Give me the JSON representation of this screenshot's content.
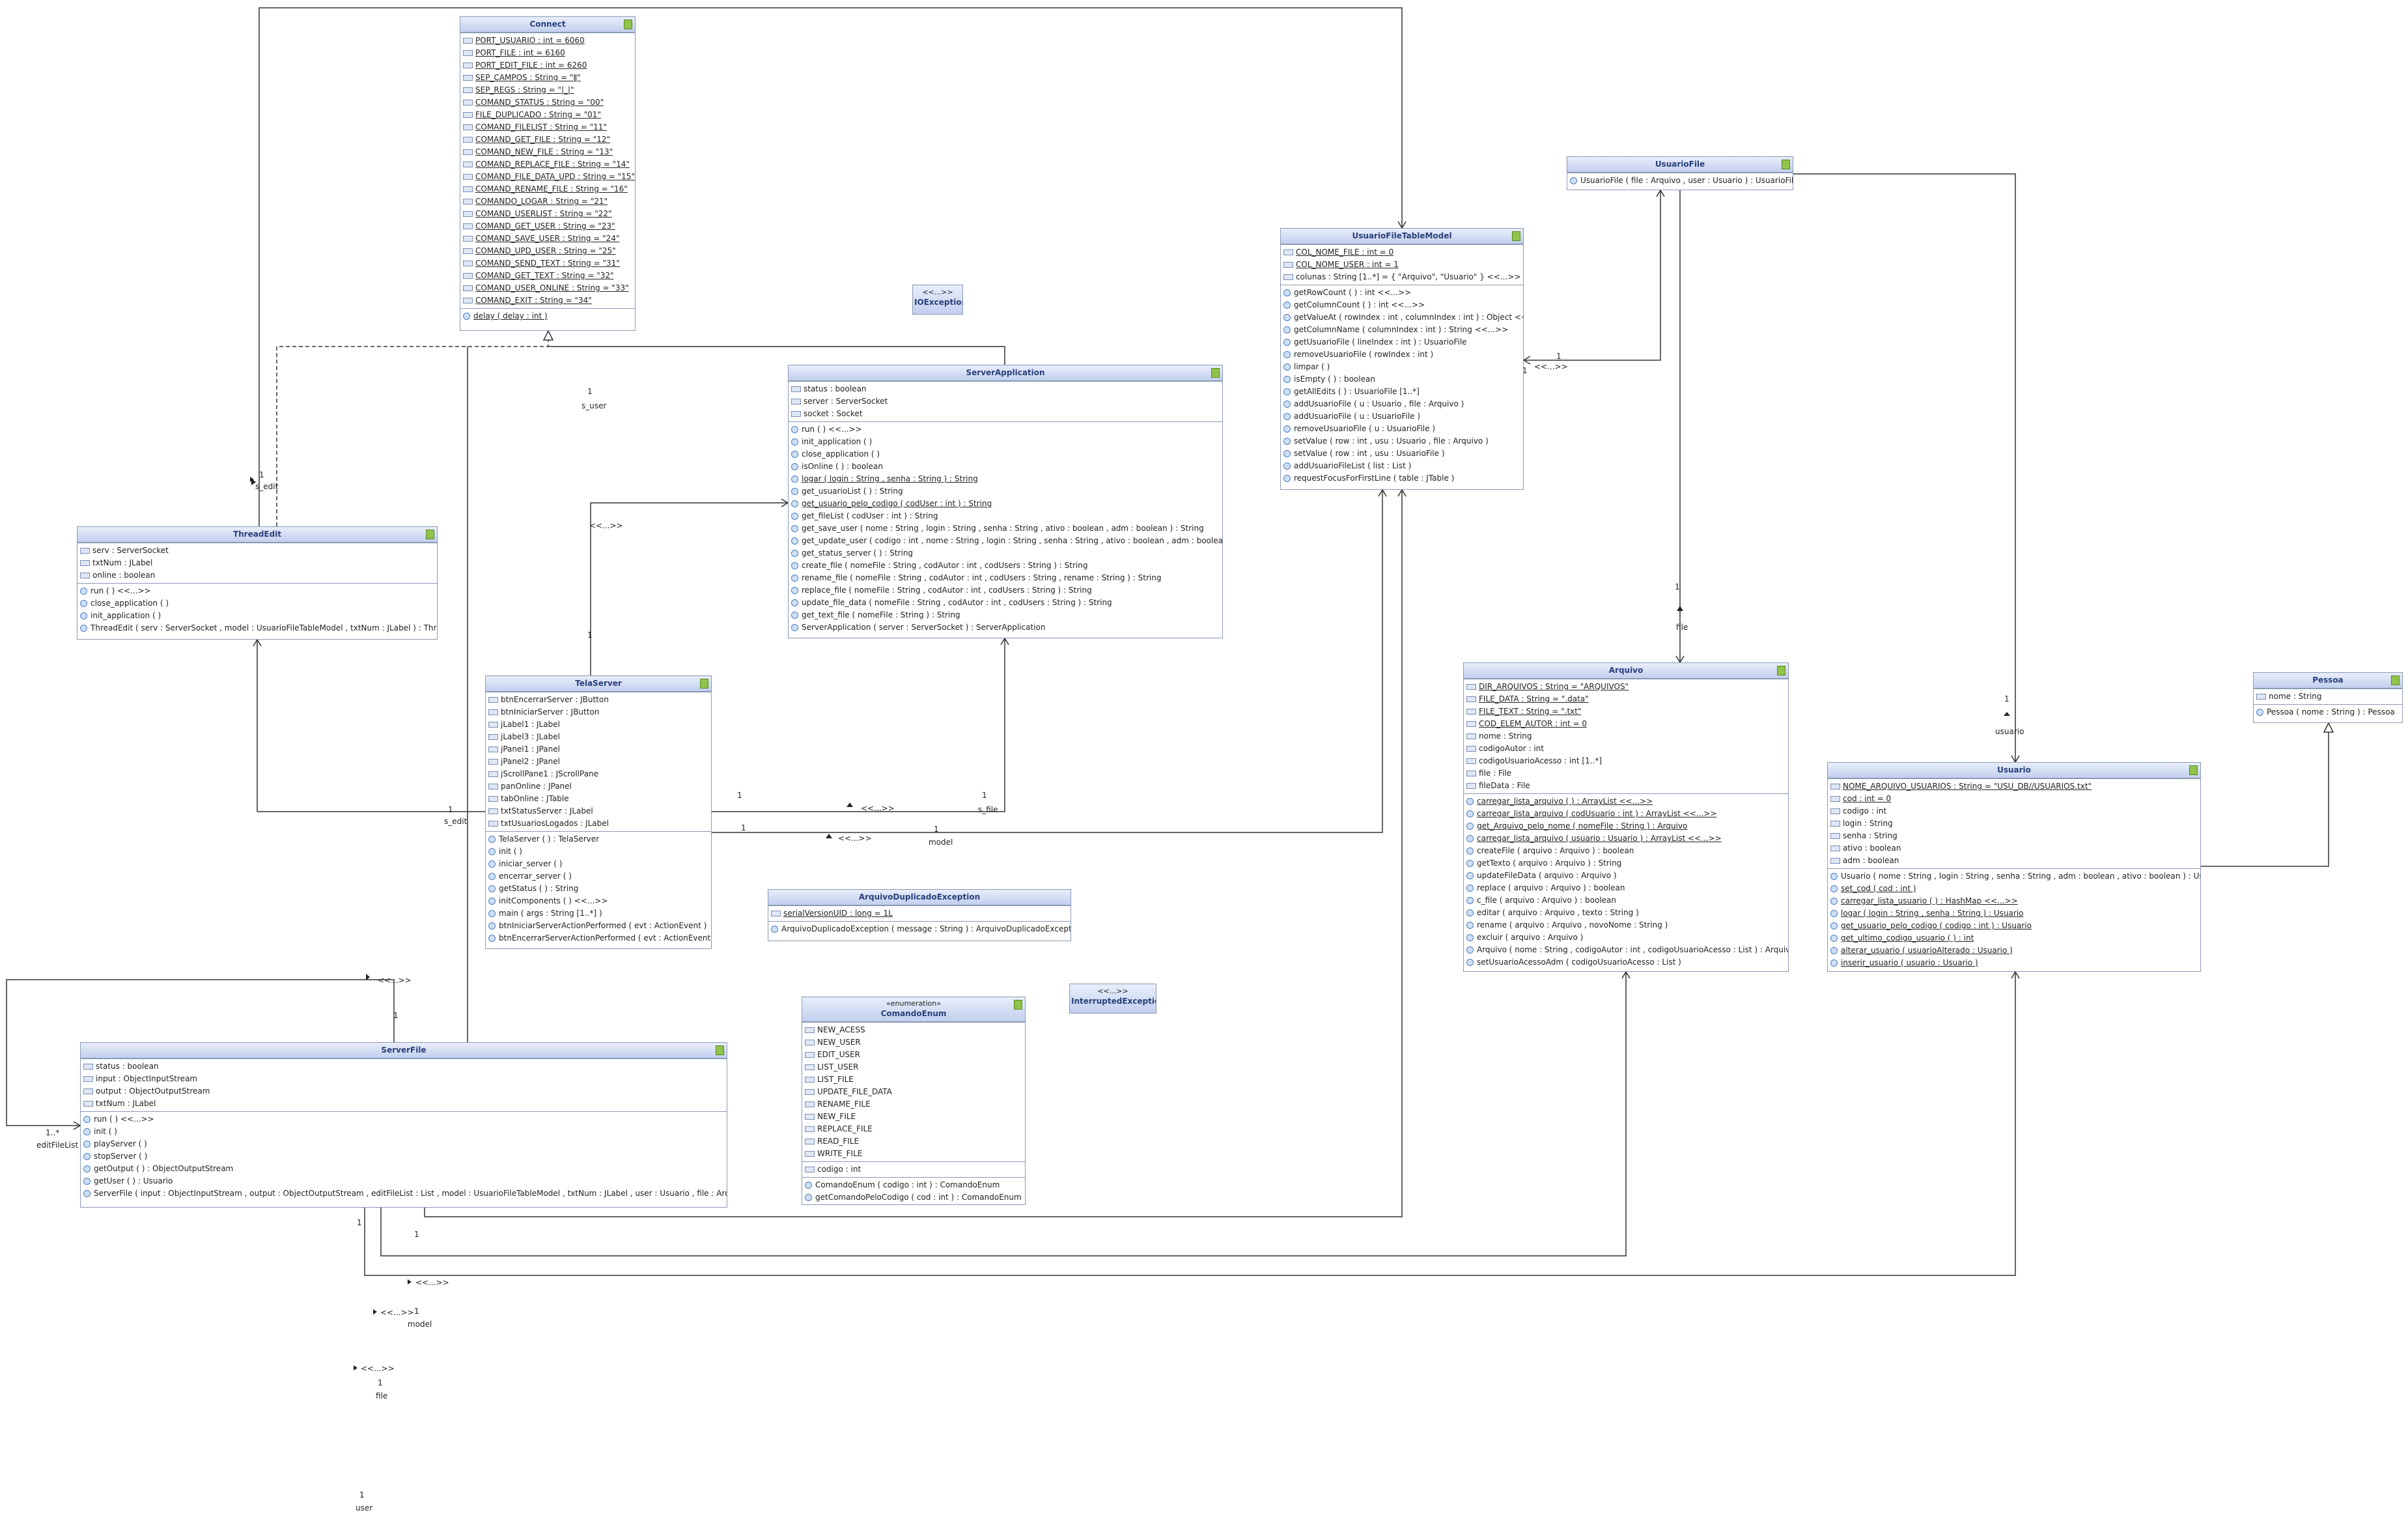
{
  "classes": {
    "connect": {
      "name": "Connect",
      "fields": [
        "PORT_USUARIO : int = 6060",
        "PORT_FILE : int = 6160",
        "PORT_EDIT_FILE : int = 6260",
        "SEP_CAMPOS : String = \"ǁ\"",
        "SEP_REGS : String = \"|_|\"",
        "COMAND_STATUS : String = \"00\"",
        "FILE_DUPLICADO : String = \"01\"",
        "COMAND_FILELIST : String = \"11\"",
        "COMAND_GET_FILE : String = \"12\"",
        "COMAND_NEW_FILE : String = \"13\"",
        "COMAND_REPLACE_FILE : String = \"14\"",
        "COMAND_FILE_DATA_UPD : String = \"15\"",
        "COMAND_RENAME_FILE : String = \"16\"",
        "COMANDO_LOGAR : String = \"21\"",
        "COMAND_USERLIST : String = \"22\"",
        "COMAND_GET_USER : String = \"23\"",
        "COMAND_SAVE_USER : String = \"24\"",
        "COMAND_UPD_USER : String = \"25\"",
        "COMAND_SEND_TEXT : String = \"31\"",
        "COMAND_GET_TEXT : String = \"32\"",
        "COMAND_USER_ONLINE : String = \"33\"",
        "COMAND_EXIT : String = \"34\""
      ],
      "methods": [
        "delay ( delay : int )"
      ]
    },
    "ioexception": {
      "stereotype": "<<...>>",
      "name": "IOException"
    },
    "server_application": {
      "name": "ServerApplication",
      "fields": [
        "status : boolean",
        "server : ServerSocket",
        "socket : Socket"
      ],
      "methods": [
        "run ( ) <<...>>",
        "init_application ( )",
        "close_application ( )",
        "isOnline ( ) : boolean",
        "logar ( login : String , senha : String ) : String",
        "get_usuarioList ( ) : String",
        "get_usuario_pelo_codigo ( codUser : int ) : String",
        "get_fileList ( codUser : int ) : String",
        "get_save_user ( nome : String , login : String , senha : String , ativo : boolean , adm : boolean ) : String",
        "get_update_user ( codigo : int , nome : String , login : String , senha : String , ativo : boolean , adm : boolean ) : String",
        "get_status_server ( ) : String",
        "create_file ( nomeFile : String , codAutor : int , codUsers : String ) : String",
        "rename_file ( nomeFile : String , codAutor : int , codUsers : String , rename : String ) : String",
        "replace_file ( nomeFile : String , codAutor : int , codUsers : String ) : String",
        "update_file_data ( nomeFile : String , codAutor : int , codUsers : String ) : String",
        "get_text_file ( nomeFile : String ) : String",
        "ServerApplication ( server : ServerSocket ) : ServerApplication"
      ]
    },
    "thread_edit": {
      "name": "ThreadEdit",
      "fields": [
        "serv : ServerSocket",
        "txtNum : JLabel",
        "online : boolean"
      ],
      "methods": [
        "run ( ) <<...>>",
        "close_application ( )",
        "init_application ( )",
        "ThreadEdit ( serv : ServerSocket , model : UsuarioFileTableModel , txtNum : JLabel ) : ThreadEdit"
      ]
    },
    "tela_server": {
      "name": "TelaServer",
      "fields": [
        "btnEncerrarServer : JButton",
        "btnIniciarServer : JButton",
        "jLabel1 : JLabel",
        "jLabel3 : JLabel",
        "jPanel1 : JPanel",
        "jPanel2 : JPanel",
        "jScrollPane1 : JScrollPane",
        "panOnline : JPanel",
        "tabOnline : JTable",
        "txtStatusServer : JLabel",
        "txtUsuariosLogados : JLabel"
      ],
      "methods": [
        "TelaServer ( ) : TelaServer",
        "init ( )",
        "iniciar_server ( )",
        "encerrar_server ( )",
        "getStatus ( ) : String",
        "initComponents ( ) <<...>>",
        "main ( args : String [1..*] )",
        "btnIniciarServerActionPerformed ( evt : ActionEvent )",
        "btnEncerrarServerActionPerformed ( evt : ActionEvent )"
      ]
    },
    "arquivo_duplicado": {
      "name": "ArquivoDuplicadoException",
      "fields": [
        "serialVersionUID : long = 1L"
      ],
      "methods": [
        "ArquivoDuplicadoException ( message : String ) : ArquivoDuplicadoException"
      ]
    },
    "interrupted": {
      "stereotype": "<<...>>",
      "name": "InterruptedException"
    },
    "comando_enum": {
      "stereotype": "«enumeration»",
      "name": "ComandoEnum",
      "literals": [
        "NEW_ACESS",
        "NEW_USER",
        "EDIT_USER",
        "LIST_USER",
        "LIST_FILE",
        "UPDATE_FILE_DATA",
        "RENAME_FILE",
        "NEW_FILE",
        "REPLACE_FILE",
        "READ_FILE",
        "WRITE_FILE"
      ],
      "fields": [
        "codigo : int"
      ],
      "methods": [
        "ComandoEnum ( codigo : int ) : ComandoEnum",
        "getComandoPeloCodigo ( cod : int ) : ComandoEnum"
      ]
    },
    "server_file": {
      "name": "ServerFile",
      "fields": [
        "status : boolean",
        "input : ObjectInputStream",
        "output : ObjectOutputStream",
        "txtNum : JLabel"
      ],
      "methods": [
        "run ( ) <<...>>",
        "init ( )",
        "playServer ( )",
        "stopServer ( )",
        "getOutput ( ) : ObjectOutputStream",
        "getUser ( ) : Usuario",
        "ServerFile ( input : ObjectInputStream , output : ObjectOutputStream , editFileList : List , model : UsuarioFileTableModel , txtNum : JLabel , user : Usuario , file : Arquivo ) : ServerFile"
      ]
    },
    "usuario_file_table_model": {
      "name": "UsuarioFileTableModel",
      "fields": [
        "COL_NOME_FILE : int = 0",
        "COL_NOME_USER : int = 1",
        "colunas : String [1..*] = { \"Arquivo\", \"Usuario\" } <<...>>"
      ],
      "methods": [
        "getRowCount ( ) : int <<...>>",
        "getColumnCount ( ) : int <<...>>",
        "getValueAt ( rowIndex : int , columnIndex : int ) : Object <<...>>",
        "getColumnName ( columnIndex : int ) : String <<...>>",
        "getUsuarioFile ( lineIndex : int ) : UsuarioFile",
        "removeUsuarioFile ( rowIndex : int )",
        "limpar ( )",
        "isEmpty ( ) : boolean",
        "getAllEdits ( ) : UsuarioFile [1..*]",
        "addUsuarioFile ( u : Usuario , file : Arquivo )",
        "addUsuarioFile ( u : UsuarioFile )",
        "removeUsuarioFile ( u : UsuarioFile )",
        "setValue ( row : int , usu : Usuario , file : Arquivo )",
        "setValue ( row : int , usu : UsuarioFile )",
        "addUsuarioFileList ( list : List )",
        "requestFocusForFirstLine ( table : JTable )"
      ]
    },
    "usuario_file": {
      "name": "UsuarioFile",
      "methods": [
        "UsuarioFile ( file : Arquivo , user : Usuario ) : UsuarioFile"
      ]
    },
    "arquivo": {
      "name": "Arquivo",
      "fields": [
        "DIR_ARQUIVOS : String = \"ARQUIVOS\"",
        "FILE_DATA : String = \".data\"",
        "FILE_TEXT : String = \".txt\"",
        "COD_ELEM_AUTOR : int = 0",
        "nome : String",
        "codigoAutor : int",
        "codigoUsuarioAcesso : int [1..*]",
        "file : File",
        "fileData : File"
      ],
      "methods": [
        "carregar_lista_arquivo ( ) : ArrayList <<...>>",
        "carregar_lista_arquivo ( codUsuario : int ) : ArrayList <<...>>",
        "get_Arquivo_pelo_nome ( nomeFile : String ) : Arquivo",
        "carregar_lista_arquivo ( usuario : Usuario ) : ArrayList <<...>>",
        "createFile ( arquivo : Arquivo ) : boolean",
        "getTexto ( arquivo : Arquivo ) : String",
        "updateFileData ( arquivo : Arquivo )",
        "replace ( arquivo : Arquivo ) : boolean",
        "c_file ( arquivo : Arquivo ) : boolean",
        "editar ( arquivo : Arquivo , texto : String )",
        "rename ( arquivo : Arquivo , novoNome : String )",
        "excluir ( arquivo : Arquivo )",
        "Arquivo ( nome : String , codigoAutor : int , codigoUsuarioAcesso : List ) : Arquivo",
        "setUsuarioAcessoAdm ( codigoUsuarioAcesso : List )"
      ]
    },
    "pessoa": {
      "name": "Pessoa",
      "fields": [
        "nome : String"
      ],
      "methods": [
        "Pessoa ( nome : String ) : Pessoa"
      ]
    },
    "usuario": {
      "name": "Usuario",
      "fields": [
        "NOME_ARQUIVO_USUARIOS : String = \"USU_DB//USUARIOS.txt\"",
        "cod : int = 0",
        "codigo : int",
        "login : String",
        "senha : String",
        "ativo : boolean",
        "adm : boolean"
      ],
      "methods": [
        "Usuario ( nome : String , login : String , senha : String , adm : boolean , ativo : boolean ) : Usuario",
        "set_cod ( cod : int )",
        "carregar_lista_usuario ( ) : HashMap <<...>>",
        "logar ( login : String , senha : String ) : Usuario",
        "get_usuario_pelo_codigo ( codigo : int ) : Usuario",
        "get_ultimo_codigo_usuario ( ) : int",
        "alterar_usuario ( usuarioAlterado : Usuario )",
        "inserir_usuario ( usuario : Usuario )"
      ]
    }
  },
  "labels": {
    "l1": "1",
    "l2": "s_user",
    "l3": "1",
    "l4": "s_edit",
    "l5": "<<...>>",
    "l6": "1",
    "l7": "1",
    "l8": "<<...>>",
    "l9": "1",
    "l10": "s_file",
    "l11": "1",
    "l12": "<<...>>",
    "l13": "1",
    "l14": "model",
    "l15": "1",
    "l16": "s_edit",
    "l17": "<<...>>",
    "l18": "1",
    "l19": "1..*",
    "l20": "editFileList",
    "l21": "1",
    "l22": "1",
    "l23": "<<...>>",
    "l24": "<<...>>",
    "l25": "1",
    "l26": "model",
    "l27": "<<...>>",
    "l28": "1",
    "l29": "file",
    "l30": "1",
    "l31": "user",
    "l32": "1",
    "l33": "<<...>>",
    "l34": "1",
    "l35": "file",
    "l36": "1",
    "l37": "usuario",
    "l38": "1"
  }
}
